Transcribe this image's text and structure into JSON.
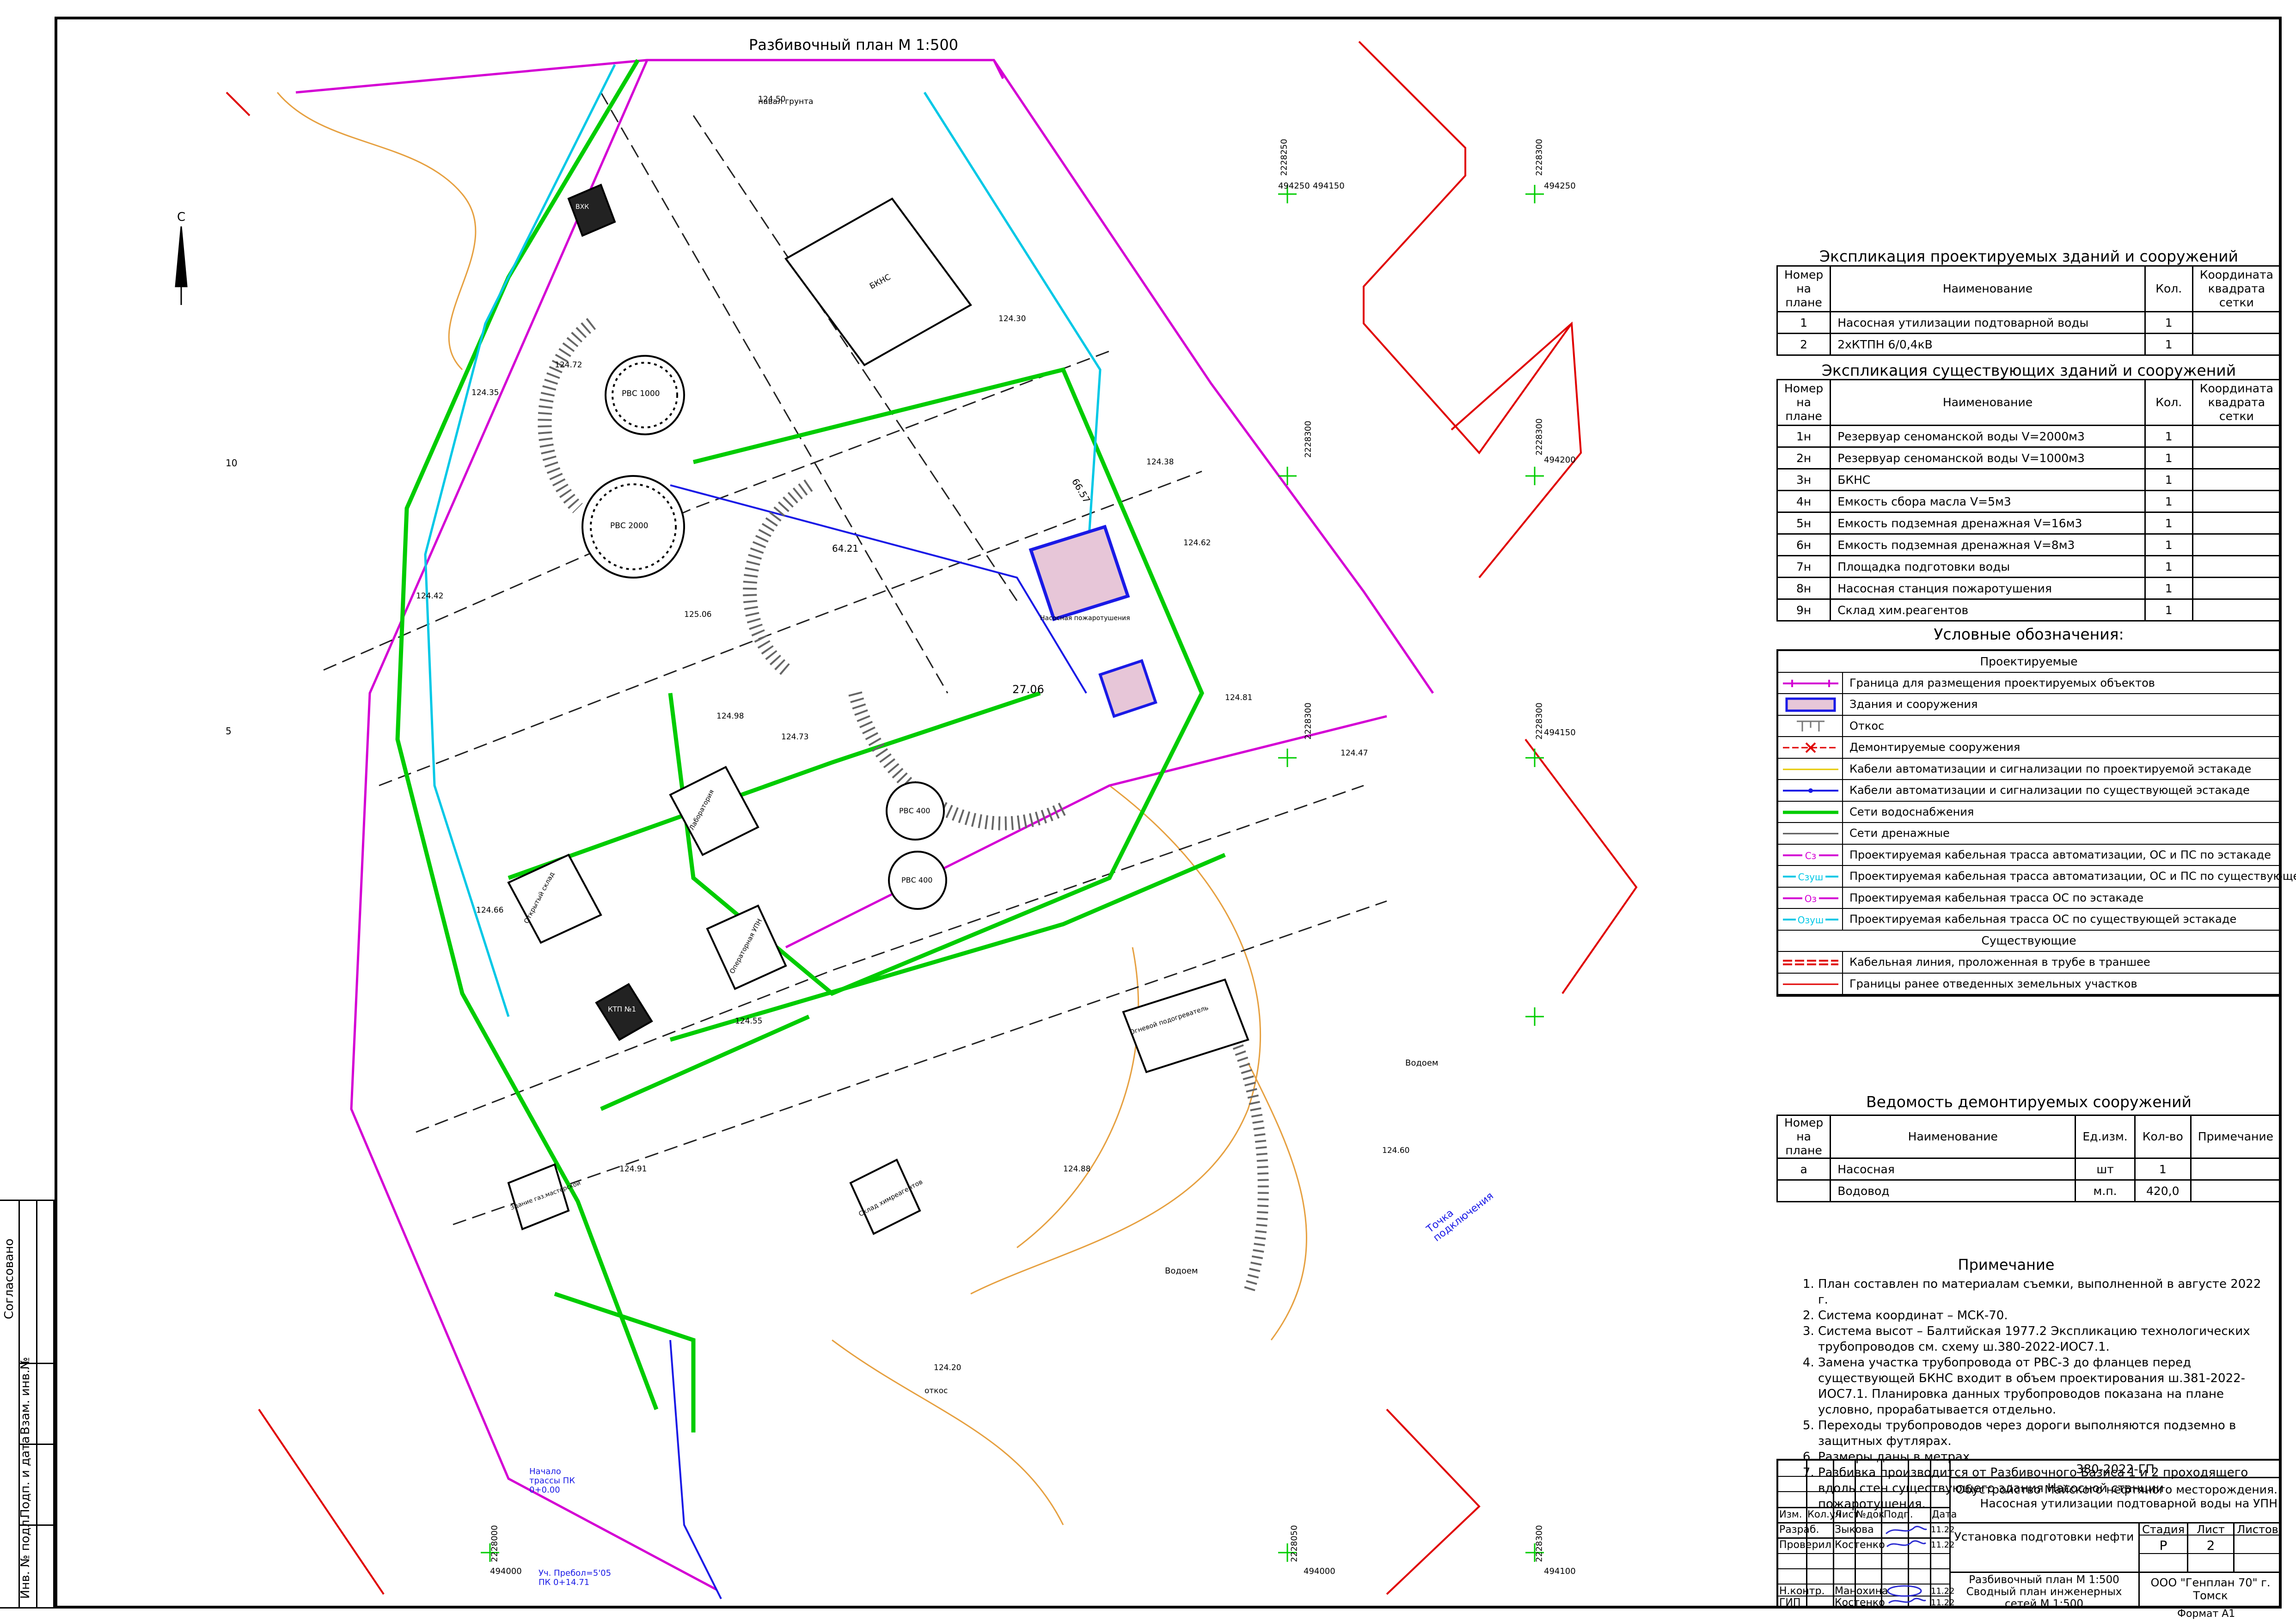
{
  "plan": {
    "title": "Разбивочный план М 1:500",
    "north": "С",
    "grid_labels": [
      "494250",
      "2228250",
      "2228300",
      "494200",
      "2228300",
      "494150",
      "2228300",
      "494150",
      "494000",
      "2228000",
      "2228050",
      "494000",
      "2228300",
      "494100"
    ],
    "building_labels": [
      "РВС 1000",
      "РВС 2000",
      "РВС 400",
      "РВС 400",
      "БКНС",
      "КТП №1",
      "Лаборатория",
      "Открытый склад",
      "Операторная УПН",
      "Огневой подогреватель",
      "Насосная пожаротушения",
      "Склад химреагентов",
      "Здание газ.мастерской",
      "ВХК"
    ],
    "spot_heights": [
      "124.50",
      "124.72",
      "125.06",
      "124.98",
      "124.30",
      "124.62",
      "124.38",
      "124.81",
      "124.47",
      "124.20",
      "124.55",
      "124.91",
      "124.66",
      "124.73",
      "124.88",
      "124.42",
      "124.35",
      "124.60"
    ],
    "annotations": [
      "Начало трассы ПК 0+0.00",
      "Уч. Пребол=5'05 ПК 0+14.71",
      "Точка подключения",
      "Водоем",
      "Водоем",
      "навал грунта",
      "откос",
      "27.06",
      "64.21",
      "66.57"
    ],
    "left_edge_marks": [
      "10",
      "5"
    ]
  },
  "expl_new": {
    "title": "Экспликация проектируемых зданий и сооружений",
    "headers": [
      "Номер на плане",
      "Наименование",
      "Кол.",
      "Координата квадрата сетки"
    ],
    "rows": [
      [
        "1",
        "Насосная утилизации подтоварной воды",
        "1",
        ""
      ],
      [
        "2",
        "2хКТПН 6/0,4кВ",
        "1",
        ""
      ]
    ]
  },
  "expl_existing": {
    "title": "Экспликация существующих зданий и сооружений",
    "headers": [
      "Номер на плане",
      "Наименование",
      "Кол.",
      "Координата квадрата сетки"
    ],
    "rows": [
      [
        "1н",
        "Резервуар сеноманской воды V=2000м3",
        "1",
        ""
      ],
      [
        "2н",
        "Резервуар сеноманской воды V=1000м3",
        "1",
        ""
      ],
      [
        "3н",
        "БКНС",
        "1",
        ""
      ],
      [
        "4н",
        "Емкость сбора масла V=5м3",
        "1",
        ""
      ],
      [
        "5н",
        "Емкость подземная дренажная V=16м3",
        "1",
        ""
      ],
      [
        "6н",
        "Емкость подземная дренажная V=8м3",
        "1",
        ""
      ],
      [
        "7н",
        "Площадка подготовки воды",
        "1",
        ""
      ],
      [
        "8н",
        "Насосная станция пожаротушения",
        "1",
        ""
      ],
      [
        "9н",
        "Склад хим.реагентов",
        "1",
        ""
      ]
    ]
  },
  "legend": {
    "title": "Условные обозначения:",
    "group_new": "Проектируемые",
    "group_existing": "Существующие",
    "items_new": [
      {
        "label": "Граница для размещения проектируемых объектов",
        "color": "#d400d4",
        "kind": "tick"
      },
      {
        "label": "Здания и сооружения",
        "color": "#1a1ae6",
        "kind": "box"
      },
      {
        "label": "Откос",
        "color": "#777777",
        "kind": "slope"
      },
      {
        "label": "Демонтируемые сооружения",
        "color": "#e00000",
        "kind": "cross"
      },
      {
        "label": "Кабели автоматизации и сигнализации по проектируемой эстакаде",
        "color": "#e6c800",
        "kind": "line"
      },
      {
        "label": "Кабели автоматизации и сигнализации по существующей эстакаде",
        "color": "#1a1ae6",
        "kind": "dotline"
      },
      {
        "label": "Сети водоснабжения",
        "color": "#00cc00",
        "kind": "thick"
      },
      {
        "label": "Сети дренажные",
        "color": "#555555",
        "kind": "line"
      },
      {
        "label": "Проектируемая кабельная трасса автоматизации, ОС и ПС по эстакаде",
        "color": "#d400d4",
        "kind": "tag",
        "tag": "Сз"
      },
      {
        "label": "Проектируемая кабельная трасса автоматизации, ОС и ПС по существующей эстакаде",
        "color": "#00c8e6",
        "kind": "tag",
        "tag": "Сзуш"
      },
      {
        "label": "Проектируемая кабельная трасса ОС по эстакаде",
        "color": "#d400d4",
        "kind": "tag",
        "tag": "Оз"
      },
      {
        "label": "Проектируемая кабельная трасса ОС по существующей эстакаде",
        "color": "#00c8e6",
        "kind": "tag",
        "tag": "Озуш"
      }
    ],
    "items_existing": [
      {
        "label": "Кабельная линия, проложенная в трубе в траншее",
        "color": "#e00000",
        "kind": "double"
      },
      {
        "label": "Границы ранее отведенных земельных участков",
        "color": "#e00000",
        "kind": "line"
      }
    ]
  },
  "demolish": {
    "title": "Ведомость демонтируемых сооружений",
    "headers": [
      "Номер на плане",
      "Наименование",
      "Ед.изм.",
      "Кол-во",
      "Примечание"
    ],
    "rows": [
      [
        "а",
        "Насосная",
        "шт",
        "1",
        ""
      ],
      [
        "",
        "Водовод",
        "м.п.",
        "420,0",
        ""
      ]
    ]
  },
  "notes": {
    "title": "Примечание",
    "items": [
      "План составлен по материалам съемки, выполненной в августе 2022 г.",
      "Система координат – МСК-70.",
      "Система высот – Балтийская 1977.2 Экспликацию технологических трубопроводов см. схему ш.380-2022-ИОС7.1.",
      "Замена участка трубопровода от РВС-3 до фланцев перед существующей БКНС входит в объем проектирования ш.381-2022-ИОС7.1. Планировка данных трубопроводов показана на плане условно, прорабатывается отдельно.",
      "Переходы трубопроводов через дороги выполняются подземно в защитных футлярах.",
      "Размеры даны в метрах.",
      "Разбивка производится от Разбивочного Базиса 1 и 2 проходящего вдоль стен существующего здания Насосной станции пожаротушения."
    ]
  },
  "title_block": {
    "code": "380-2022-ГП",
    "project": "Обустройство Майского нефтяного месторождения. Насосная утилизации подтоварной воды на УПН",
    "object": "Установка подготовки нефти",
    "sheet_title": "Разбивочный план М 1:500 Сводный план инженерных сетей М 1:500",
    "company": "ООО \"Генплан 70\" г. Томск",
    "col_headers": [
      "Изм.",
      "Кол.уч",
      "Лист",
      "№док",
      "Подп.",
      "Дата"
    ],
    "people": [
      {
        "role": "Разраб.",
        "name": "Зыкова",
        "date": "11.22"
      },
      {
        "role": "Проверил",
        "name": "Костенко",
        "date": "11.22"
      },
      {
        "role": "Н.контр.",
        "name": "Манохина",
        "date": "11.22"
      },
      {
        "role": "ГИП",
        "name": "Костенко",
        "date": "11.22"
      }
    ],
    "stage_headers": [
      "Стадия",
      "Лист",
      "Листов"
    ],
    "stage": "Р",
    "sheet": "2",
    "sheets": "",
    "format": "Формат А1"
  },
  "margin": {
    "agreed": "Согласовано",
    "fields": [
      "Взам. инв.№",
      "Подп. и дата",
      "Инв. № подл."
    ]
  }
}
